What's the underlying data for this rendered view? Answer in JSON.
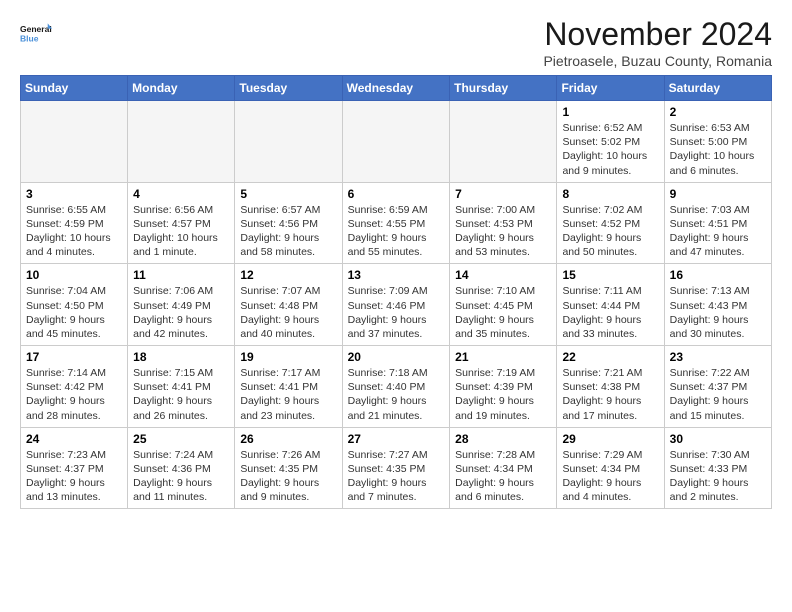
{
  "logo": {
    "line1": "General",
    "line2": "Blue"
  },
  "title": "November 2024",
  "location": "Pietroasele, Buzau County, Romania",
  "headers": [
    "Sunday",
    "Monday",
    "Tuesday",
    "Wednesday",
    "Thursday",
    "Friday",
    "Saturday"
  ],
  "weeks": [
    [
      {
        "day": "",
        "info": ""
      },
      {
        "day": "",
        "info": ""
      },
      {
        "day": "",
        "info": ""
      },
      {
        "day": "",
        "info": ""
      },
      {
        "day": "",
        "info": ""
      },
      {
        "day": "1",
        "info": "Sunrise: 6:52 AM\nSunset: 5:02 PM\nDaylight: 10 hours and 9 minutes."
      },
      {
        "day": "2",
        "info": "Sunrise: 6:53 AM\nSunset: 5:00 PM\nDaylight: 10 hours and 6 minutes."
      }
    ],
    [
      {
        "day": "3",
        "info": "Sunrise: 6:55 AM\nSunset: 4:59 PM\nDaylight: 10 hours and 4 minutes."
      },
      {
        "day": "4",
        "info": "Sunrise: 6:56 AM\nSunset: 4:57 PM\nDaylight: 10 hours and 1 minute."
      },
      {
        "day": "5",
        "info": "Sunrise: 6:57 AM\nSunset: 4:56 PM\nDaylight: 9 hours and 58 minutes."
      },
      {
        "day": "6",
        "info": "Sunrise: 6:59 AM\nSunset: 4:55 PM\nDaylight: 9 hours and 55 minutes."
      },
      {
        "day": "7",
        "info": "Sunrise: 7:00 AM\nSunset: 4:53 PM\nDaylight: 9 hours and 53 minutes."
      },
      {
        "day": "8",
        "info": "Sunrise: 7:02 AM\nSunset: 4:52 PM\nDaylight: 9 hours and 50 minutes."
      },
      {
        "day": "9",
        "info": "Sunrise: 7:03 AM\nSunset: 4:51 PM\nDaylight: 9 hours and 47 minutes."
      }
    ],
    [
      {
        "day": "10",
        "info": "Sunrise: 7:04 AM\nSunset: 4:50 PM\nDaylight: 9 hours and 45 minutes."
      },
      {
        "day": "11",
        "info": "Sunrise: 7:06 AM\nSunset: 4:49 PM\nDaylight: 9 hours and 42 minutes."
      },
      {
        "day": "12",
        "info": "Sunrise: 7:07 AM\nSunset: 4:48 PM\nDaylight: 9 hours and 40 minutes."
      },
      {
        "day": "13",
        "info": "Sunrise: 7:09 AM\nSunset: 4:46 PM\nDaylight: 9 hours and 37 minutes."
      },
      {
        "day": "14",
        "info": "Sunrise: 7:10 AM\nSunset: 4:45 PM\nDaylight: 9 hours and 35 minutes."
      },
      {
        "day": "15",
        "info": "Sunrise: 7:11 AM\nSunset: 4:44 PM\nDaylight: 9 hours and 33 minutes."
      },
      {
        "day": "16",
        "info": "Sunrise: 7:13 AM\nSunset: 4:43 PM\nDaylight: 9 hours and 30 minutes."
      }
    ],
    [
      {
        "day": "17",
        "info": "Sunrise: 7:14 AM\nSunset: 4:42 PM\nDaylight: 9 hours and 28 minutes."
      },
      {
        "day": "18",
        "info": "Sunrise: 7:15 AM\nSunset: 4:41 PM\nDaylight: 9 hours and 26 minutes."
      },
      {
        "day": "19",
        "info": "Sunrise: 7:17 AM\nSunset: 4:41 PM\nDaylight: 9 hours and 23 minutes."
      },
      {
        "day": "20",
        "info": "Sunrise: 7:18 AM\nSunset: 4:40 PM\nDaylight: 9 hours and 21 minutes."
      },
      {
        "day": "21",
        "info": "Sunrise: 7:19 AM\nSunset: 4:39 PM\nDaylight: 9 hours and 19 minutes."
      },
      {
        "day": "22",
        "info": "Sunrise: 7:21 AM\nSunset: 4:38 PM\nDaylight: 9 hours and 17 minutes."
      },
      {
        "day": "23",
        "info": "Sunrise: 7:22 AM\nSunset: 4:37 PM\nDaylight: 9 hours and 15 minutes."
      }
    ],
    [
      {
        "day": "24",
        "info": "Sunrise: 7:23 AM\nSunset: 4:37 PM\nDaylight: 9 hours and 13 minutes."
      },
      {
        "day": "25",
        "info": "Sunrise: 7:24 AM\nSunset: 4:36 PM\nDaylight: 9 hours and 11 minutes."
      },
      {
        "day": "26",
        "info": "Sunrise: 7:26 AM\nSunset: 4:35 PM\nDaylight: 9 hours and 9 minutes."
      },
      {
        "day": "27",
        "info": "Sunrise: 7:27 AM\nSunset: 4:35 PM\nDaylight: 9 hours and 7 minutes."
      },
      {
        "day": "28",
        "info": "Sunrise: 7:28 AM\nSunset: 4:34 PM\nDaylight: 9 hours and 6 minutes."
      },
      {
        "day": "29",
        "info": "Sunrise: 7:29 AM\nSunset: 4:34 PM\nDaylight: 9 hours and 4 minutes."
      },
      {
        "day": "30",
        "info": "Sunrise: 7:30 AM\nSunset: 4:33 PM\nDaylight: 9 hours and 2 minutes."
      }
    ]
  ]
}
